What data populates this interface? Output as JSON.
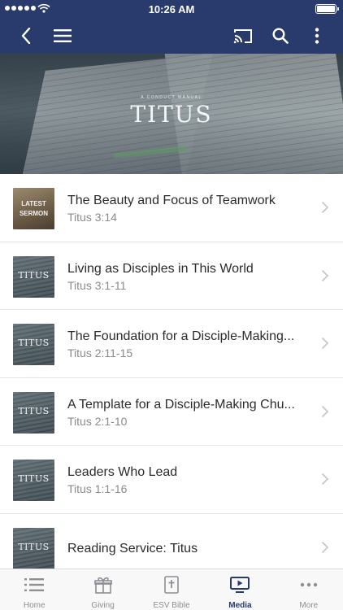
{
  "status_bar": {
    "time": "10:26 AM"
  },
  "nav": {
    "back_icon": "chevron-left-icon",
    "menu_icon": "hamburger-icon",
    "cast_icon": "cast-icon",
    "search_icon": "search-icon",
    "more_icon": "vertical-dots-icon"
  },
  "hero": {
    "kicker": "A CONDUCT MANUAL",
    "title": "TITUS"
  },
  "sermons": [
    {
      "thumb_type": "latest",
      "thumb_text": "LATEST SERMON",
      "title": "The Beauty and Focus of Teamwork",
      "reference": "Titus 3:14"
    },
    {
      "thumb_type": "titus",
      "thumb_text": "TITUS",
      "title": "Living as Disciples in This World",
      "reference": "Titus 3:1-11"
    },
    {
      "thumb_type": "titus",
      "thumb_text": "TITUS",
      "title": "The Foundation for a Disciple-Making...",
      "reference": "Titus 2:11-15"
    },
    {
      "thumb_type": "titus",
      "thumb_text": "TITUS",
      "title": "A Template for a Disciple-Making Chu...",
      "reference": "Titus 2:1-10"
    },
    {
      "thumb_type": "titus",
      "thumb_text": "TITUS",
      "title": "Leaders Who Lead",
      "reference": "Titus 1:1-16"
    },
    {
      "thumb_type": "titus",
      "thumb_text": "TITUS",
      "title": "Reading Service: Titus",
      "reference": ""
    }
  ],
  "tabs": [
    {
      "label": "Home",
      "icon": "list-icon",
      "active": false
    },
    {
      "label": "Giving",
      "icon": "gift-icon",
      "active": false
    },
    {
      "label": "ESV Bible",
      "icon": "bible-icon",
      "active": false
    },
    {
      "label": "Media",
      "icon": "media-icon",
      "active": true
    },
    {
      "label": "More",
      "icon": "more-dots-icon",
      "active": false
    }
  ],
  "colors": {
    "brand": "#293a6c",
    "tab_inactive": "#8e8e93"
  }
}
